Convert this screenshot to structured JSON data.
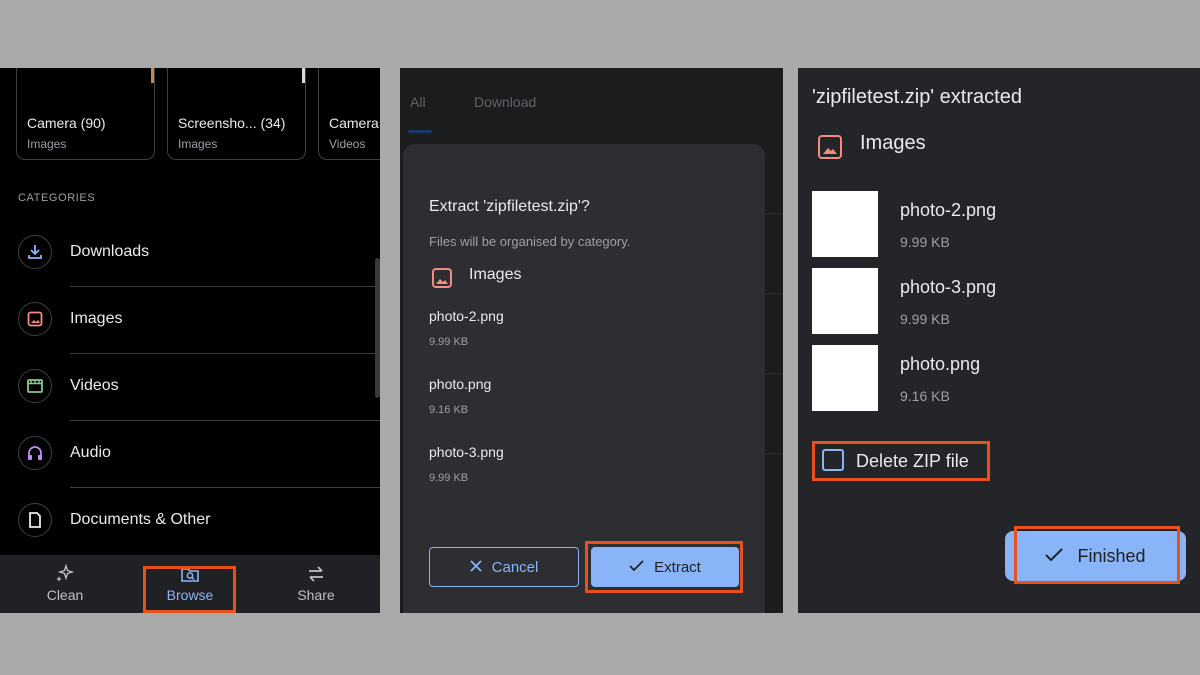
{
  "panel1": {
    "folders": [
      {
        "name": "Camera (90)",
        "sub": "Images"
      },
      {
        "name": "Screensho... (34)",
        "sub": "Images"
      },
      {
        "name": "Camera",
        "sub": "Videos"
      }
    ],
    "categories_heading": "CATEGORIES",
    "categories": [
      {
        "label": "Downloads",
        "icon": "download-icon"
      },
      {
        "label": "Images",
        "icon": "image-icon"
      },
      {
        "label": "Videos",
        "icon": "video-icon"
      },
      {
        "label": "Audio",
        "icon": "headphones-icon"
      },
      {
        "label": "Documents & Other",
        "icon": "document-icon"
      }
    ],
    "bottom_nav": [
      {
        "label": "Clean",
        "icon": "sparkle-icon"
      },
      {
        "label": "Browse",
        "icon": "browse-icon",
        "active": true
      },
      {
        "label": "Share",
        "icon": "swap-icon"
      }
    ]
  },
  "panel2": {
    "tabs": [
      "All",
      "Download"
    ],
    "dialog": {
      "title": "Extract 'zipfiletest.zip'?",
      "subtitle": "Files will be organised by category.",
      "category": "Images",
      "files": [
        {
          "name": "photo-2.png",
          "size": "9.99 KB"
        },
        {
          "name": "photo.png",
          "size": "9.16 KB"
        },
        {
          "name": "photo-3.png",
          "size": "9.99 KB"
        }
      ],
      "cancel_label": "Cancel",
      "extract_label": "Extract"
    }
  },
  "panel3": {
    "title": "'zipfiletest.zip' extracted",
    "category": "Images",
    "files": [
      {
        "name": "photo-2.png",
        "size": "9.99 KB"
      },
      {
        "name": "photo-3.png",
        "size": "9.99 KB"
      },
      {
        "name": "photo.png",
        "size": "9.16 KB"
      }
    ],
    "delete_label": "Delete ZIP file",
    "delete_checked": false,
    "finished_label": "Finished"
  },
  "colors": {
    "accent": "#8ab4f8",
    "highlight": "#e8501c",
    "image_icon": "#f28b82",
    "background": "#aaaaaa"
  }
}
